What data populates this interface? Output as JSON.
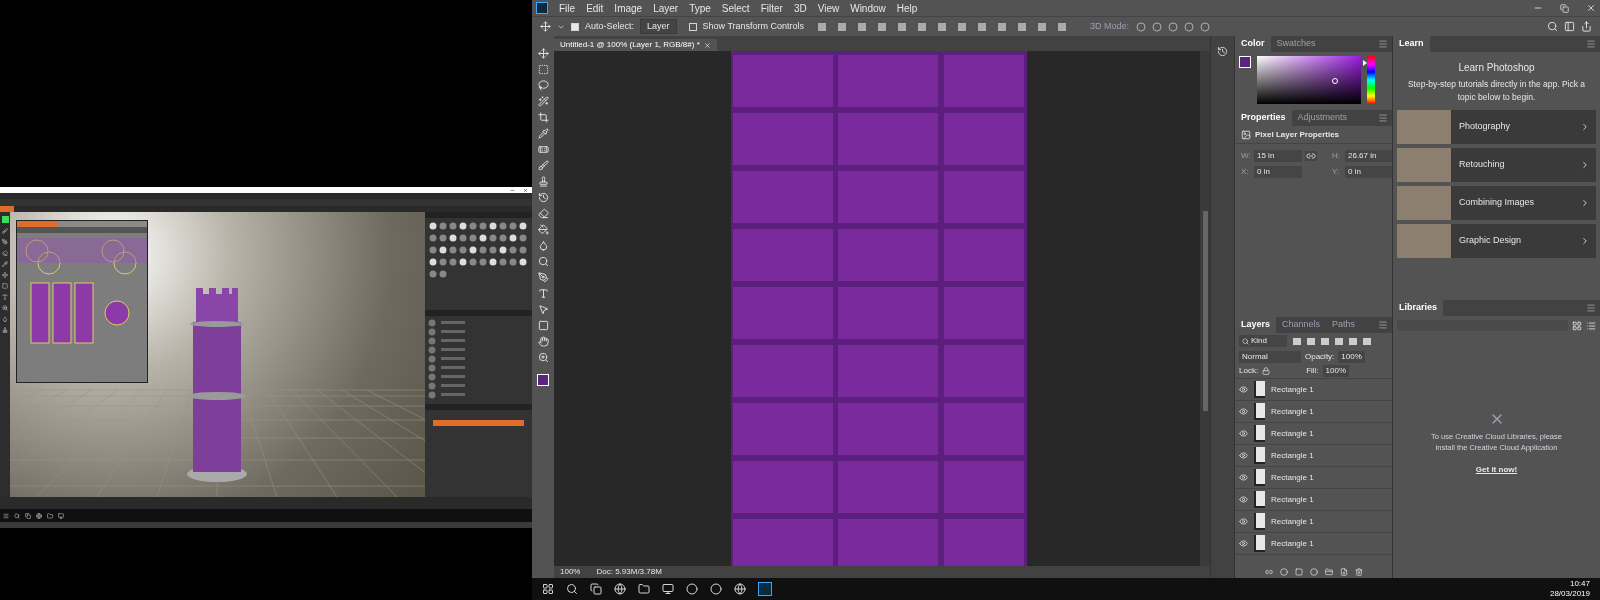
{
  "photoshop": {
    "menu": [
      "File",
      "Edit",
      "Image",
      "Layer",
      "Type",
      "Select",
      "Filter",
      "3D",
      "View",
      "Window",
      "Help"
    ],
    "options_bar": {
      "auto_select": {
        "label": "Auto-Select:",
        "checked": true,
        "target": "Layer"
      },
      "transform_controls": {
        "label": "Show Transform Controls",
        "checked": false
      },
      "mode_label": "3D Mode:"
    },
    "document_tab": "Untitled-1 @ 100% (Layer 1, RGB/8#) *",
    "status_bar": {
      "zoom": "100%",
      "doc": "Doc: 5.93M/3.78M"
    },
    "color_panel": {
      "tabs": [
        {
          "label": "Color",
          "selected": true
        },
        {
          "label": "Swatches",
          "selected": false
        }
      ],
      "hue_slider": {
        "level": 0.85
      }
    },
    "properties_panel": {
      "tabs": [
        {
          "label": "Properties",
          "selected": true
        },
        {
          "label": "Adjustments",
          "selected": false
        }
      ],
      "heading": "Pixel Layer Properties",
      "fields": [
        {
          "label": "W:",
          "value": "15 in"
        },
        {
          "label": "H:",
          "value": "26.67 in"
        },
        {
          "label": "X:",
          "value": "0 in"
        },
        {
          "label": "Y:",
          "value": "0 in"
        }
      ]
    },
    "layers_panel": {
      "tabs": [
        {
          "label": "Layers",
          "selected": true
        },
        {
          "label": "Channels",
          "selected": false
        },
        {
          "label": "Paths",
          "selected": false
        }
      ],
      "filter": "Kind",
      "blend_mode": "Normal",
      "opacity_label": "Opacity:",
      "opacity": "100%",
      "lock_label": "Lock:",
      "fill_label": "Fill:",
      "fill": "100%",
      "layers": [
        {
          "name": "Rectangle 1",
          "visible": true
        },
        {
          "name": "Rectangle 1",
          "visible": true
        },
        {
          "name": "Rectangle 1",
          "visible": true
        },
        {
          "name": "Rectangle 1",
          "visible": true
        },
        {
          "name": "Rectangle 1",
          "visible": true
        },
        {
          "name": "Rectangle 1",
          "visible": true
        },
        {
          "name": "Rectangle 1",
          "visible": true
        },
        {
          "name": "Rectangle 1",
          "visible": true
        }
      ]
    },
    "learn_panel": {
      "tab": "Learn",
      "title": "Learn Photoshop",
      "description": "Step-by-step tutorials directly in the app. Pick a topic below to begin.",
      "topics": [
        "Photography",
        "Retouching",
        "Combining Images",
        "Graphic Design"
      ]
    },
    "libraries_panel": {
      "tab": "Libraries",
      "message": "To use Creative Cloud Libraries, please install the Creative Cloud Application",
      "link": "Get it now!"
    }
  },
  "taskbar": {
    "time": "10:47",
    "date": "28/03/2019"
  }
}
